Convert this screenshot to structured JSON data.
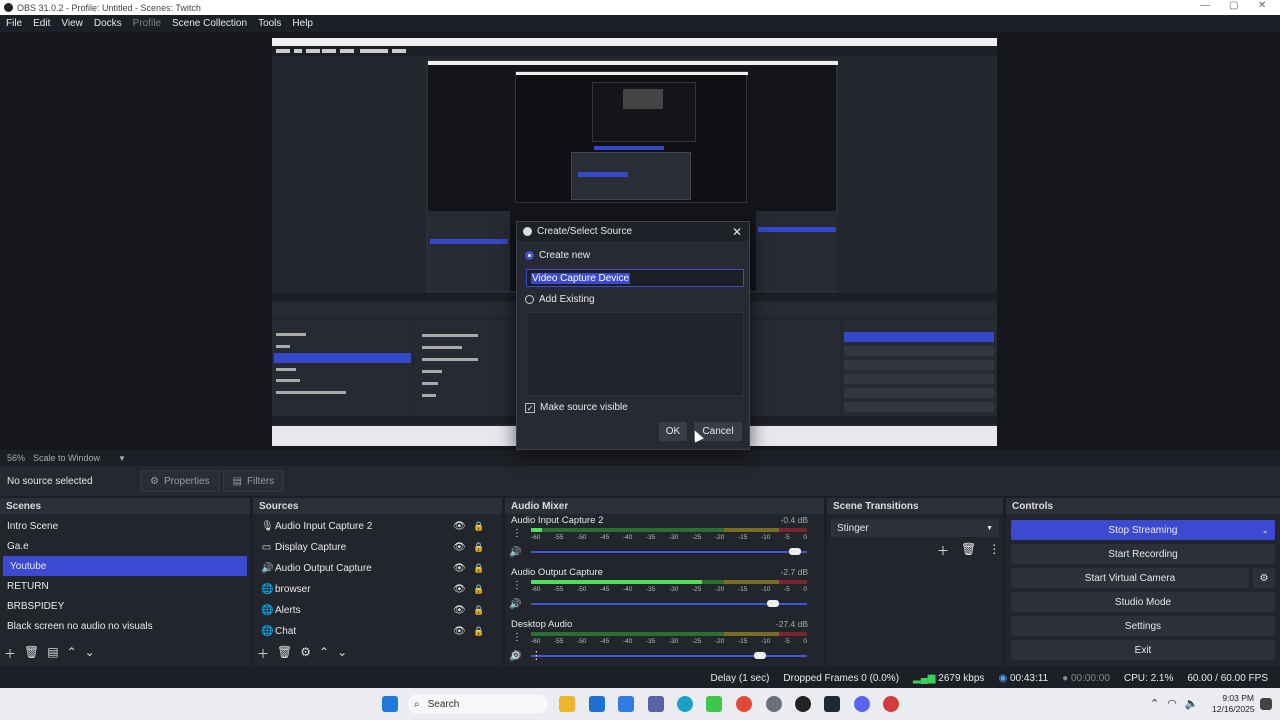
{
  "window": {
    "title": "OBS 31.0.2 - Profile: Untitled - Scenes: Twitch",
    "minimize": "—",
    "maximize": "▢",
    "close": "✕"
  },
  "menu": {
    "items": [
      "File",
      "Edit",
      "View",
      "Docks",
      "Profile",
      "Scene Collection",
      "Tools",
      "Help"
    ]
  },
  "zoom": {
    "percent": "56%",
    "mode": "Scale to Window"
  },
  "properties_bar": {
    "no_source": "No source selected",
    "properties_label": "Properties",
    "filters_label": "Filters"
  },
  "scenes": {
    "title": "Scenes",
    "items": [
      "Intro Scene",
      "Ga.e",
      "Youtube",
      "RETURN",
      "BRBSPIDEY",
      "Black screen no audio no visuals"
    ],
    "selected": "Youtube"
  },
  "sources": {
    "title": "Sources",
    "items": [
      {
        "label": "Audio Input Capture 2",
        "icon": "microphone-icon"
      },
      {
        "label": "Display Capture",
        "icon": "monitor-icon"
      },
      {
        "label": "Audio Output Capture",
        "icon": "speaker-icon"
      },
      {
        "label": "browser",
        "icon": "globe-icon"
      },
      {
        "label": "Alerts",
        "icon": "globe-icon"
      },
      {
        "label": "Chat",
        "icon": "globe-icon"
      }
    ]
  },
  "mixer": {
    "title": "Audio Mixer",
    "ticks": [
      "-60",
      "-55",
      "-50",
      "-45",
      "-40",
      "-35",
      "-30",
      "-25",
      "-20",
      "-15",
      "-10",
      "-5",
      "0"
    ],
    "channels": [
      {
        "name": "Audio Input Capture 2",
        "db": "-0.4 dB",
        "level": 0.04,
        "volume": 0.98
      },
      {
        "name": "Audio Output Capture",
        "db": "-2.7 dB",
        "level": 0.62,
        "volume": 0.9
      },
      {
        "name": "Desktop Audio",
        "db": "-27.4 dB",
        "level": 0.0,
        "volume": 0.85
      }
    ]
  },
  "transitions": {
    "title": "Scene Transitions",
    "selected": "Stinger"
  },
  "controls": {
    "title": "Controls",
    "buttons": [
      "Stop Streaming",
      "Start Recording",
      "Start Virtual Camera",
      "Studio Mode",
      "Settings",
      "Exit"
    ]
  },
  "status": {
    "delay": "Delay (1 sec)",
    "dropped": "Dropped Frames 0 (0.0%)",
    "bitrate": "2679 kbps",
    "stream_time": "00:43:11",
    "rec_time": "00:00:00",
    "cpu": "CPU: 2.1%",
    "fps": "60.00 / 60.00 FPS"
  },
  "taskbar": {
    "search": "Search",
    "time": "9:03 PM",
    "date": "12/16/2025"
  },
  "dialog": {
    "title": "Create/Select Source",
    "create_new": "Create new",
    "name_value": "Video Capture Device",
    "add_existing": "Add Existing",
    "make_visible": "Make source visible",
    "ok": "OK",
    "cancel": "Cancel"
  },
  "colors": {
    "accent": "#3b4ad0",
    "background": "#1d1f26",
    "meter_green": "#2a6e31",
    "meter_yellow": "#7a6a24",
    "meter_red": "#7a2430"
  }
}
